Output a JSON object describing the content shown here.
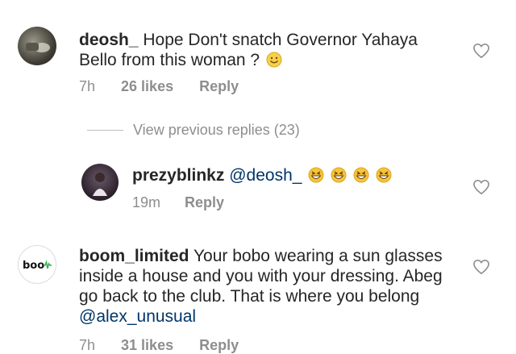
{
  "comments": [
    {
      "username": "deosh_",
      "text": " Hope Don't snatch Governor Yahaya Bello from this woman ? ",
      "emoji": "smiling-face-emoji",
      "time": "7h",
      "likes": "26 likes",
      "reply": "Reply"
    },
    {
      "username": "boom_limited",
      "text": " Your bobo wearing a sun glasses inside a house and you with your dressing. Abeg go back to the club. That is where you belong ",
      "mention": "@alex_unusual",
      "avatar_logo": "boom",
      "time": "7h",
      "likes": "31 likes",
      "reply": "Reply"
    }
  ],
  "view_previous": "View previous replies (23)",
  "reply_comment": {
    "username": "prezyblinkz",
    "mention": "@deosh_",
    "emojis": [
      "grinning-squinting-face-emoji",
      "grinning-squinting-face-emoji",
      "grinning-squinting-face-emoji",
      "grinning-squinting-face-emoji"
    ],
    "time": "19m",
    "reply": "Reply"
  },
  "colors": {
    "text": "#262626",
    "meta": "#8e8e8e",
    "mention": "#003569",
    "emoji": "#f7c33c"
  }
}
